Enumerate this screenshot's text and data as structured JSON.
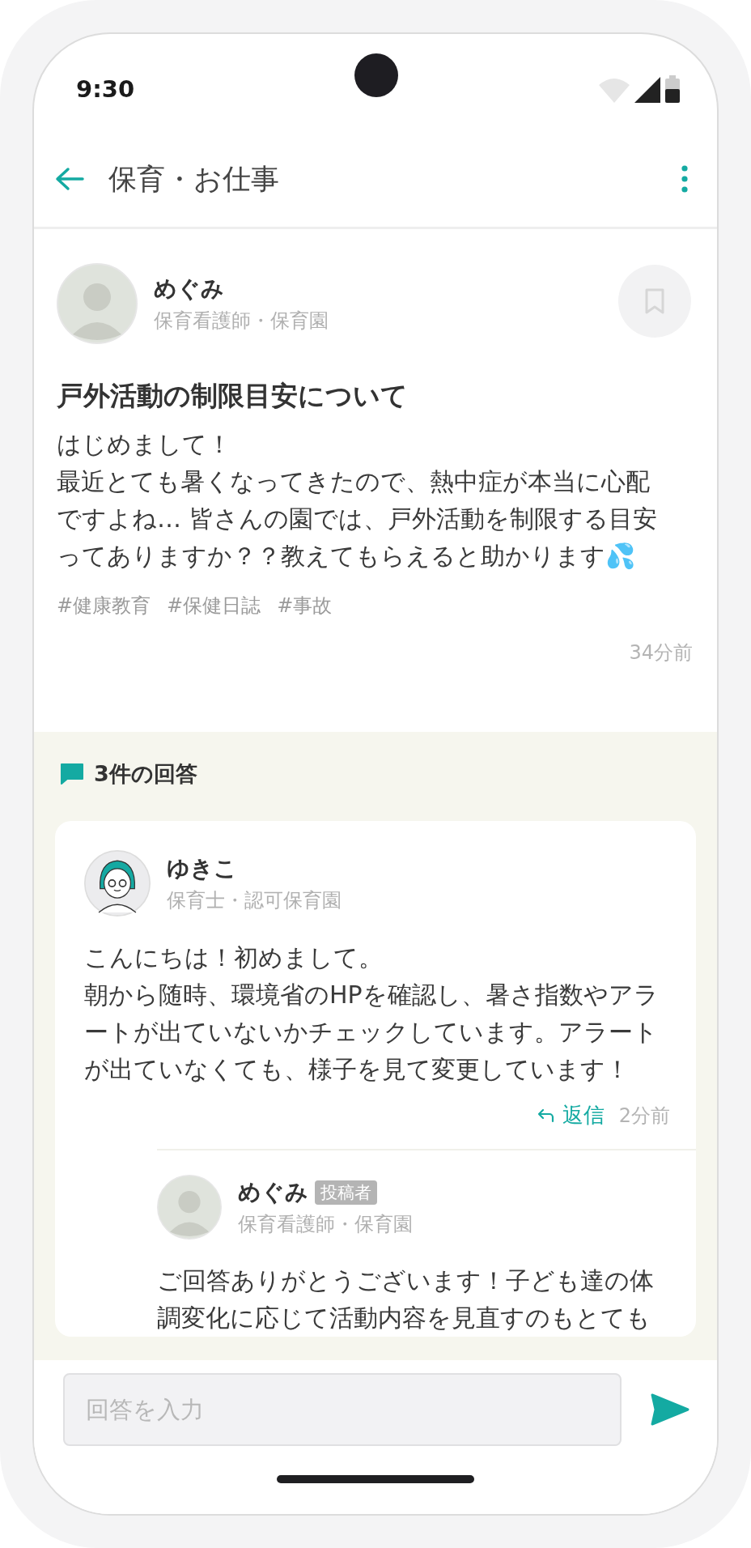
{
  "status_bar": {
    "time": "9:30"
  },
  "app_bar": {
    "title": "保育・お仕事"
  },
  "post": {
    "author": {
      "name": "めぐみ",
      "role": "保育看護師・保育園",
      "avatar": {
        "kind": "photo"
      }
    },
    "bookmarked": false,
    "title": "戸外活動の制限目安について",
    "paragraphs": [
      "はじめまして！",
      "最近とても暑くなってきたので、熱中症が本当に心配ですよね… 皆さんの園では、戸外活動を制限する目安ってありますか？？教えてもらえると助かります💦"
    ],
    "tags": [
      "#健康教育",
      "#保健日誌",
      "#事故"
    ],
    "time": "34分前"
  },
  "answers": {
    "count_label": "3件の回答",
    "items": [
      {
        "author": {
          "name": "ゆきこ",
          "role": "保育士・認可保育園",
          "avatar": {
            "kind": "illustration"
          }
        },
        "paragraphs": [
          "こんにちは！初めまして。",
          "朝から随時、環境省のHPを確認し、暑さ指数やアラートが出ていないかチェックしています。アラートが出ていなくても、様子を見て変更しています！"
        ],
        "reply_label": "返信",
        "time": "2分前",
        "replies": [
          {
            "author": {
              "name": "めぐみ",
              "badge": "投稿者",
              "role": "保育看護師・保育園",
              "avatar": {
                "kind": "photo"
              }
            },
            "paragraphs": [
              "ご回答ありがとうございます！子ども達の体調変化に応じて活動内容を見直すのもとても"
            ]
          }
        ]
      }
    ]
  },
  "composer": {
    "placeholder": "回答を入力"
  }
}
